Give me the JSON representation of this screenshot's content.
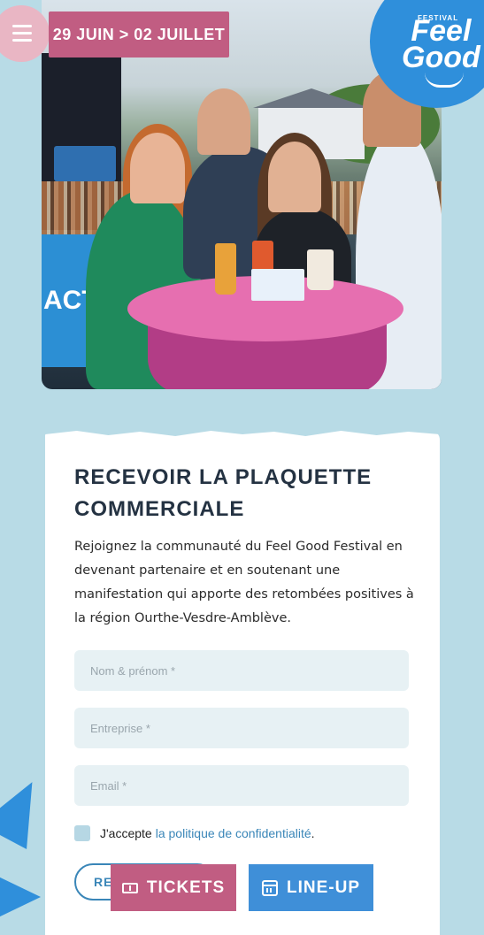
{
  "header": {
    "dates": "29 JUIN > 02 JUILLET",
    "logo_small": "FESTIVAL",
    "logo_line1": "Feel",
    "logo_line2": "Good"
  },
  "photo": {
    "banner_text": "ACT"
  },
  "form": {
    "title": "RECEVOIR LA PLAQUETTE COMMERCIALE",
    "description": "Rejoignez la communauté du Feel Good Festival en devenant partenaire et en soutenant une manifestation qui apporte des retombées positives à la région Ourthe-Vesdre-Amblève.",
    "name_placeholder": "Nom & prénom *",
    "company_placeholder": "Entreprise *",
    "email_placeholder": "Email *",
    "consent_text": "J'accepte",
    "consent_link": "la politique de confidentialité",
    "consent_end": ".",
    "submit_label": "RE"
  },
  "bottom_bar": {
    "tickets_label": "TICKETS",
    "lineup_label": "LINE-UP"
  },
  "colors": {
    "background": "#b8dbe6",
    "pink": "#c15d82",
    "blue": "#3f8fd8",
    "title": "#243242"
  }
}
